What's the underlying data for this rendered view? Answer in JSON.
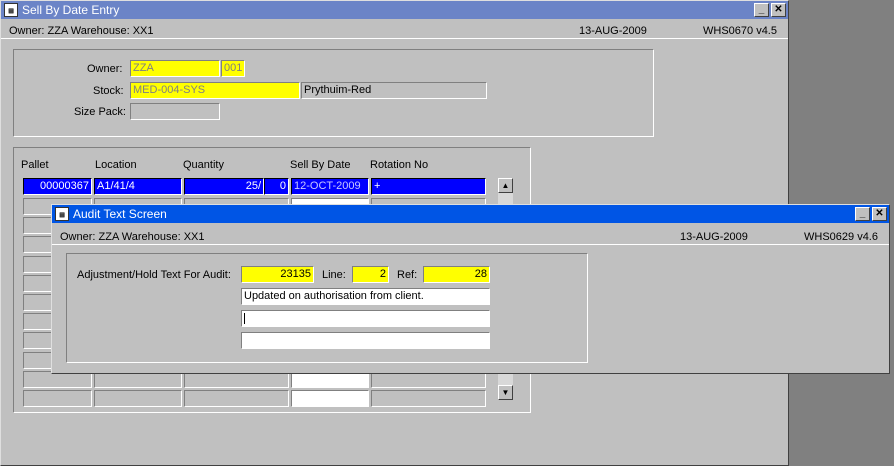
{
  "main_window": {
    "title": "Sell By Date Entry",
    "icon": "app-icon",
    "owner_info": "Owner:  ZZA    Warehouse:  XX1",
    "date": "13-AUG-2009",
    "version": "WHS0670  v4.5",
    "owner_label": "Owner:",
    "owner_code": "ZZA",
    "owner_num": "001",
    "stock_label": "Stock:",
    "stock_code": "MED-004-SYS",
    "stock_desc": "Prythuim-Red",
    "sizepack_label": "Size Pack:",
    "sizepack_value": "",
    "columns": [
      "Pallet",
      "Location",
      "Quantity",
      "Sell By Date",
      "Rotation No"
    ],
    "row": {
      "pallet": "00000367",
      "location": "A1/41/4",
      "qty": "25/",
      "qty2": "0",
      "sell_by": "12-OCT-2009",
      "rotation": "+"
    }
  },
  "audit_window": {
    "title": "Audit Text Screen",
    "icon": "app-icon",
    "owner_info": "Owner:  ZZA    Warehouse:  XX1",
    "date": "13-AUG-2009",
    "version": "WHS0629  v4.6",
    "adjust_label": "Adjustment/Hold Text For Audit:",
    "adjust_value": "23135",
    "line_label": "Line:",
    "line_value": "2",
    "ref_label": "Ref:",
    "ref_value": "28",
    "text_line1": "Updated on authorisation from client.",
    "text_line2": "",
    "text_line3": ""
  },
  "buttons": {
    "minimize": "_",
    "close": "✕",
    "scroll_up": "▲",
    "scroll_down": "▼"
  },
  "colors": {
    "main_title": "#6b84c7",
    "audit_title": "#0055e5",
    "field_yellow": "#ffff00",
    "selected_row": "#0000ff"
  }
}
